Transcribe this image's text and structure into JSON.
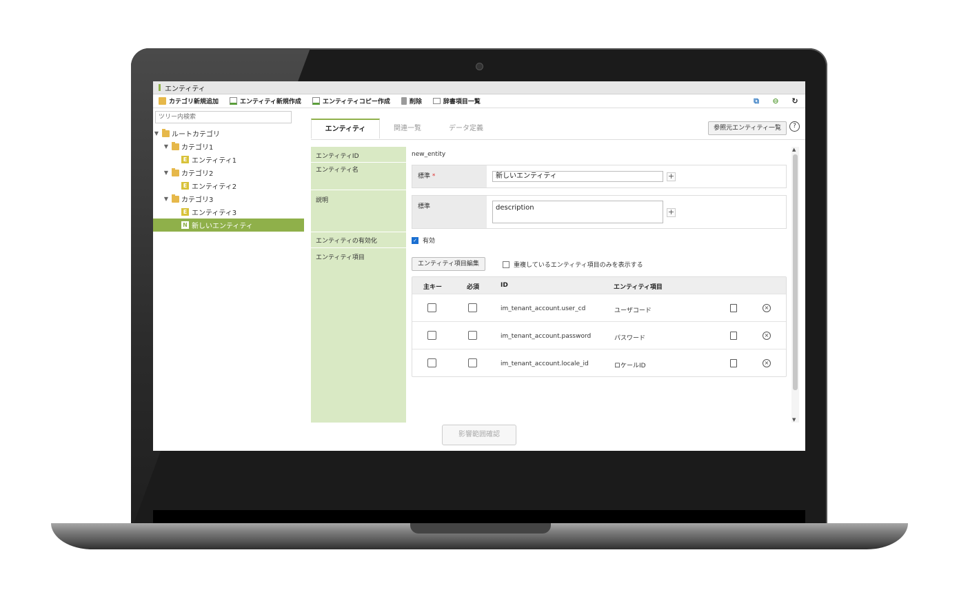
{
  "window": {
    "title": "エンティティ"
  },
  "toolbar": {
    "add_category": "カテゴリ新規追加",
    "new_entity": "エンティティ新規作成",
    "copy_entity": "エンティティコピー作成",
    "delete": "削除",
    "dictionary_list": "辞書項目一覧",
    "right_icons": [
      "diagram-icon",
      "back-icon",
      "refresh-icon"
    ]
  },
  "tree": {
    "search_placeholder": "ツリー内検索",
    "root": "ルートカテゴリ",
    "items": [
      {
        "label": "カテゴリ1",
        "type": "folder"
      },
      {
        "label": "エンティティ1",
        "type": "entity",
        "badge": "E"
      },
      {
        "label": "カテゴリ2",
        "type": "folder"
      },
      {
        "label": "エンティティ2",
        "type": "entity",
        "badge": "E"
      },
      {
        "label": "カテゴリ3",
        "type": "folder"
      },
      {
        "label": "エンティティ3",
        "type": "entity",
        "badge": "E"
      },
      {
        "label": "新しいエンティティ",
        "type": "new",
        "badge": "N",
        "selected": true
      }
    ]
  },
  "tabs": [
    {
      "label": "エンティティ",
      "active": true
    },
    {
      "label": "関連一覧",
      "active": false
    },
    {
      "label": "データ定義",
      "active": false
    }
  ],
  "header_actions": {
    "ref_entity_list": "参照元エンティティ一覧",
    "help": "?"
  },
  "form": {
    "entity_id": {
      "label": "エンティティID",
      "value": "new_entity"
    },
    "entity_name": {
      "label": "エンティティ名",
      "sub_label": "標準",
      "required": "*",
      "value": "新しいエンティティ"
    },
    "description": {
      "label": "説明",
      "sub_label": "標準",
      "value": "description"
    },
    "enabled": {
      "label": "エンティティの有効化",
      "checkbox_label": "有効",
      "checked": true
    },
    "fields": {
      "label": "エンティティ項目",
      "edit_button": "エンティティ項目編集",
      "duplicate_only_label": "重複しているエンティティ項目のみを表示する",
      "columns": [
        "主キー",
        "必須",
        "ID",
        "エンティティ項目"
      ],
      "rows": [
        {
          "id": "im_tenant_account.user_cd",
          "name": "ユーザコード"
        },
        {
          "id": "im_tenant_account.password",
          "name": "パスワード"
        },
        {
          "id": "im_tenant_account.locale_id",
          "name": "ロケールID"
        }
      ]
    }
  },
  "confirm_button": "影響範囲確認",
  "colors": {
    "accent": "#8fb04a",
    "label_bg": "#d9e9c4"
  }
}
